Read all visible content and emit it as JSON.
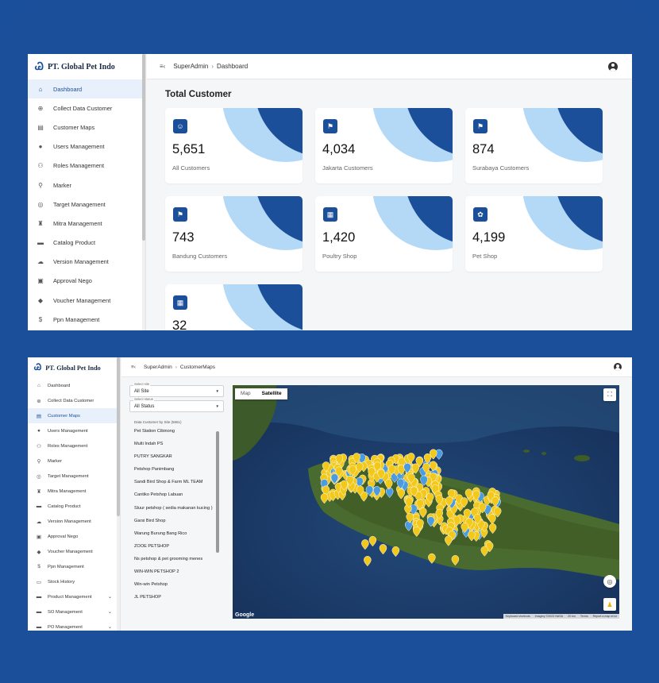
{
  "brand": "PT. Global Pet Indo",
  "dashboard": {
    "breadcrumb_user": "SuperAdmin",
    "breadcrumb_page": "Dashboard",
    "title": "Total Customer",
    "nav": [
      {
        "label": "Dashboard",
        "icon": "home-icon",
        "active": true
      },
      {
        "label": "Collect Data Customer",
        "icon": "collect-icon"
      },
      {
        "label": "Customer Maps",
        "icon": "map-icon"
      },
      {
        "label": "Users Management",
        "icon": "user-icon"
      },
      {
        "label": "Roles Management",
        "icon": "roles-icon"
      },
      {
        "label": "Marker",
        "icon": "marker-icon"
      },
      {
        "label": "Target Management",
        "icon": "target-icon"
      },
      {
        "label": "Mitra Management",
        "icon": "mitra-icon"
      },
      {
        "label": "Catalog Product",
        "icon": "catalog-icon"
      },
      {
        "label": "Version Management",
        "icon": "cloud-icon"
      },
      {
        "label": "Approval Nego",
        "icon": "approval-icon"
      },
      {
        "label": "Voucher Management",
        "icon": "voucher-icon"
      },
      {
        "label": "Ppn Management",
        "icon": "ppn-icon"
      }
    ],
    "cards": [
      {
        "value": "5,651",
        "label": "All Customers",
        "icon": "users-icon"
      },
      {
        "value": "4,034",
        "label": "Jakarta Customers",
        "icon": "flag-icon"
      },
      {
        "value": "874",
        "label": "Surabaya Customers",
        "icon": "flag-icon"
      },
      {
        "value": "743",
        "label": "Bandung Customers",
        "icon": "flag-icon"
      },
      {
        "value": "1,420",
        "label": "Poultry Shop",
        "icon": "shop-icon"
      },
      {
        "value": "4,199",
        "label": "Pet Shop",
        "icon": "pet-shop-icon"
      },
      {
        "value": "32",
        "label": "",
        "icon": "shop-icon"
      }
    ],
    "colors": {
      "accent": "#1c4f9a",
      "accent_light": "#b3d9f7"
    }
  },
  "maps": {
    "breadcrumb_user": "SuperAdmin",
    "breadcrumb_page": "CustomerMaps",
    "nav": [
      {
        "label": "Dashboard",
        "icon": "home-icon"
      },
      {
        "label": "Collect Data Customer",
        "icon": "collect-icon"
      },
      {
        "label": "Customer Maps",
        "icon": "map-icon",
        "active": true
      },
      {
        "label": "Users Management",
        "icon": "user-icon"
      },
      {
        "label": "Roles Management",
        "icon": "roles-icon"
      },
      {
        "label": "Marker",
        "icon": "marker-icon"
      },
      {
        "label": "Target Management",
        "icon": "target-icon"
      },
      {
        "label": "Mitra Management",
        "icon": "mitra-icon"
      },
      {
        "label": "Catalog Product",
        "icon": "catalog-icon"
      },
      {
        "label": "Version Management",
        "icon": "cloud-icon"
      },
      {
        "label": "Approval Nego",
        "icon": "approval-icon"
      },
      {
        "label": "Voucher Management",
        "icon": "voucher-icon"
      },
      {
        "label": "Ppn Management",
        "icon": "ppn-icon"
      },
      {
        "label": "Stock History",
        "icon": "stock-icon"
      },
      {
        "label": "Product Management",
        "icon": "product-icon",
        "expandable": true
      },
      {
        "label": "SO Management",
        "icon": "so-icon",
        "expandable": true
      },
      {
        "label": "PO Management",
        "icon": "po-icon",
        "expandable": true
      }
    ],
    "site_filter": {
      "label": "Select site",
      "value": "All Site"
    },
    "status_filter": {
      "label": "Select status",
      "value": "All Status"
    },
    "site_list_header": "Data Customer by Site (5651)",
    "sites": [
      "Pet Station Cibinong",
      "Multi Indah PS",
      "PUTRY SANGKAR",
      "Petshop Panimbang",
      "Sandi Bird Shop & Farm ML TEAM",
      "Cantiko Petshop Labuan",
      "Sluur petshop ( sedia makanan kucing )",
      "Garsi Bird Shop",
      "Warung Burung Bang Rico",
      "ZOOE PETSHOP",
      "Ns petshop & pet grooming menes",
      "WIN-WIN PETSHOP 2",
      "Win-win Petshop",
      "JL PETSHOP"
    ],
    "map_tabs": {
      "map": "Map",
      "satellite": "Satellite"
    },
    "google": "Google",
    "attribution": [
      "Keyboard shortcuts",
      "Imagery ©2023 NASA",
      "20 km",
      "Terms",
      "Report a map error"
    ]
  }
}
